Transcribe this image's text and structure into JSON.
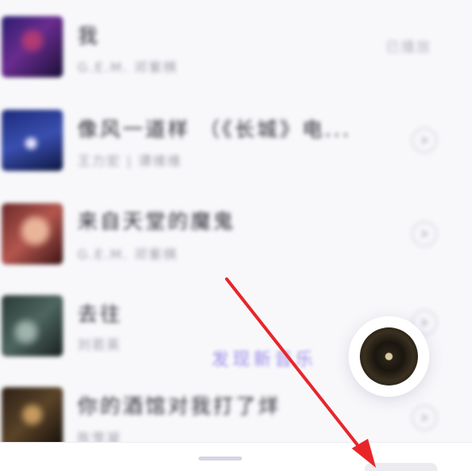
{
  "songs": [
    {
      "title": "我",
      "subtitle": "G.E.M. 邓紫棋",
      "status": "已播放"
    },
    {
      "title": "像风一道样 （《长城》电...",
      "subtitle": "王力宏 | 谭维维"
    },
    {
      "title": "来自天堂的魔鬼",
      "subtitle": "G.E.M. 邓紫棋"
    },
    {
      "title": "去往",
      "subtitle": "刘若英"
    },
    {
      "title": "你的酒馆对我打了烊",
      "subtitle": "陈雪凝"
    }
  ],
  "discover_label": "发现新音乐",
  "colors": {
    "accent": "#9b8ee6",
    "arrow": "#e8262a"
  },
  "icons": {
    "play": "play-circle-icon",
    "disc": "vinyl-disc-icon"
  }
}
